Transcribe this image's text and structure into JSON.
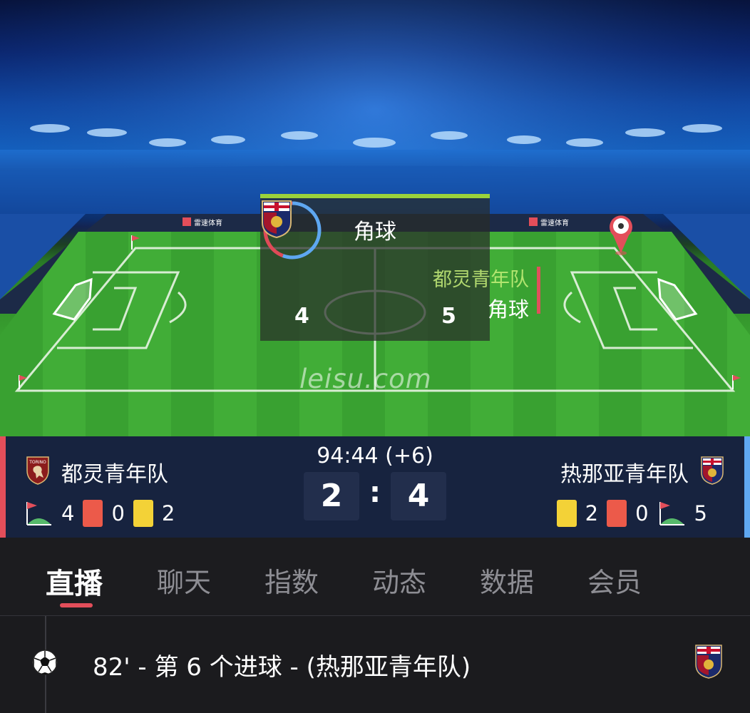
{
  "overlay": {
    "title": "角球",
    "home_count": "4",
    "away_count": "5"
  },
  "ticker": {
    "team": "都灵青年队",
    "event": "角球"
  },
  "watermark": "leisu.com",
  "stadium": {
    "board_text": "雷速体育"
  },
  "match": {
    "clock": "94:44 (+6)",
    "home": {
      "name": "都灵青年队",
      "badge_text": "TORINO",
      "corners": "4",
      "red_cards": "0",
      "yellow_cards": "2",
      "score": "2"
    },
    "away": {
      "name": "热那亚青年队",
      "corners": "5",
      "red_cards": "0",
      "yellow_cards": "2",
      "score": "4"
    },
    "separator": ":"
  },
  "tabs": [
    {
      "label": "直播",
      "active": true
    },
    {
      "label": "聊天"
    },
    {
      "label": "指数"
    },
    {
      "label": "动态"
    },
    {
      "label": "数据"
    },
    {
      "label": "会员"
    }
  ],
  "feed": [
    {
      "text": "82' - 第 6 个进球 - (热那亚青年队)",
      "icon": "soccer-ball-icon"
    }
  ],
  "colors": {
    "home_accent": "#e34e5a",
    "away_accent": "#5fa8f2",
    "overlay_accent": "#9bd23b",
    "red_card": "#ec5a4a",
    "yellow_card": "#f3d237"
  }
}
